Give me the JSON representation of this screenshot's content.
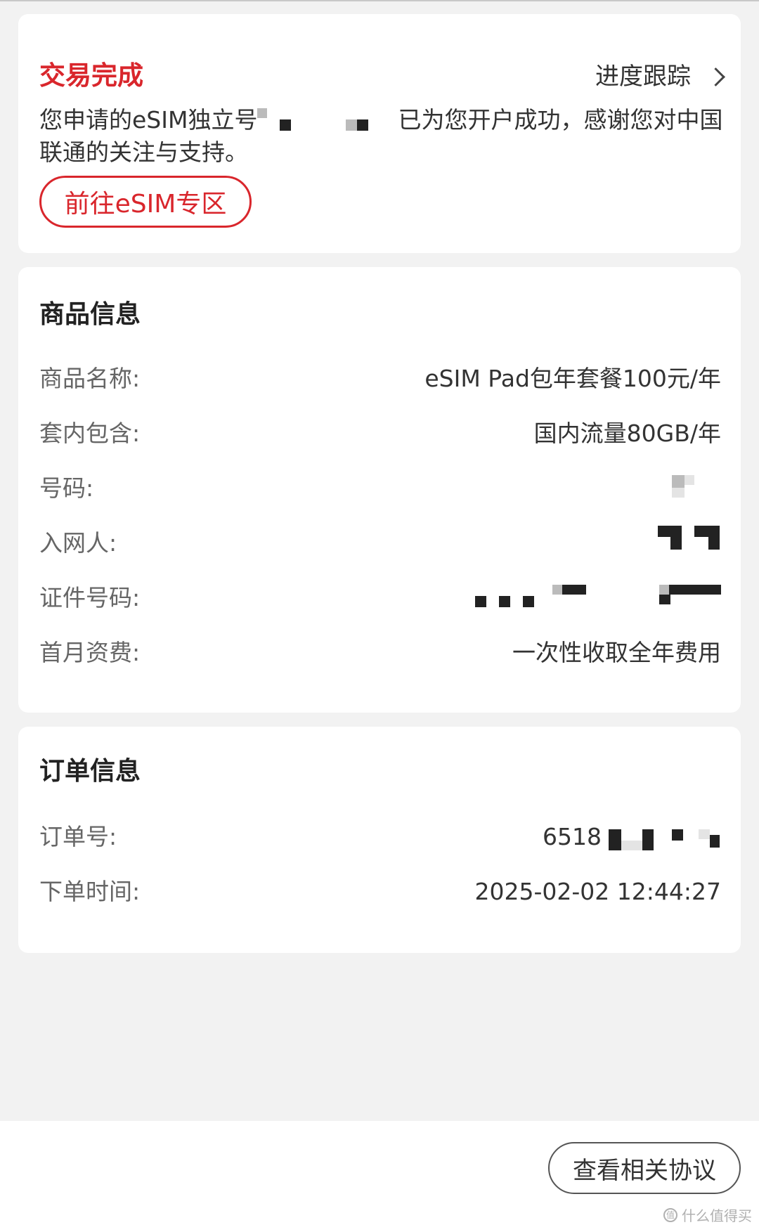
{
  "status": {
    "title": "交易完成",
    "progress_link_label": "进度跟踪",
    "message_prefix": "您申请的eSIM独立号",
    "message_suffix": "已为您开户成功，感谢您对中国联通的关注与支持。",
    "esim_button_label": "前往eSIM专区"
  },
  "product": {
    "title": "商品信息",
    "rows": [
      {
        "label": "商品名称:",
        "value": "eSIM Pad包年套餐100元/年"
      },
      {
        "label": "套内包含:",
        "value": "国内流量80GB/年"
      },
      {
        "label": "号码:",
        "value": ""
      },
      {
        "label": "入网人:",
        "value": ""
      },
      {
        "label": "证件号码:",
        "value": ""
      },
      {
        "label": "首月资费:",
        "value": "一次性收取全年费用"
      }
    ]
  },
  "order": {
    "title": "订单信息",
    "rows": [
      {
        "label": "订单号:",
        "value": "6518"
      },
      {
        "label": "下单时间:",
        "value": "2025-02-02 12:44:27"
      }
    ]
  },
  "footer": {
    "agreement_button_label": "查看相关协议",
    "watermark_text": "什么值得买"
  },
  "colors": {
    "accent": "#d9262c",
    "background": "#f2f2f2",
    "card": "#ffffff"
  }
}
